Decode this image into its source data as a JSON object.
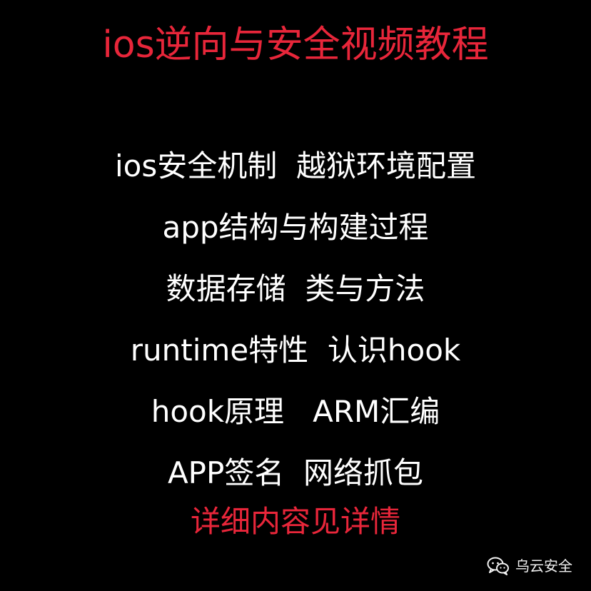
{
  "title": "ios逆向与安全视频教程",
  "topics": [
    "ios安全机制  越狱环境配置",
    "app结构与构建过程",
    "数据存储  类与方法",
    "runtime特性  认识hook",
    "hook原理   ARM汇编",
    "APP签名  网络抓包"
  ],
  "footer_text": "详细内容见详情",
  "watermark": {
    "icon": "wechat-icon",
    "label": "乌云安全"
  },
  "colors": {
    "background": "#000000",
    "accent": "#e8263a",
    "text": "#ffffff"
  }
}
